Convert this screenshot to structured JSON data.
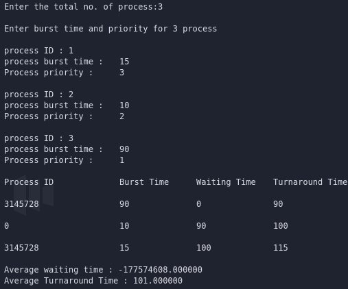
{
  "prompts": {
    "total_process": "Enter the total no. of process:3",
    "burst_priority": "Enter burst time and priority for 3 process"
  },
  "processes": [
    {
      "id_label": "process ID : 1",
      "burst_label": "process burst time :",
      "burst_value": "15",
      "priority_label": "Process priority :",
      "priority_value": "3"
    },
    {
      "id_label": "process ID : 2",
      "burst_label": "process burst time :",
      "burst_value": "10",
      "priority_label": "Process priority :",
      "priority_value": "2"
    },
    {
      "id_label": "process ID : 3",
      "burst_label": "process burst time :",
      "burst_value": "90",
      "priority_label": "Process priority :",
      "priority_value": "1"
    }
  ],
  "table": {
    "headers": [
      "Process ID",
      "Burst Time",
      "Waiting Time",
      "Turnaround Time"
    ],
    "rows": [
      [
        "3145728",
        "90",
        "0",
        "90"
      ],
      [
        "0",
        "10",
        "90",
        "100"
      ],
      [
        "3145728",
        "15",
        "100",
        "115"
      ]
    ]
  },
  "summary": {
    "avg_waiting": "Average waiting time : -177574608.000000",
    "avg_turnaround": "Average Turnaround Time : 101.000000"
  }
}
